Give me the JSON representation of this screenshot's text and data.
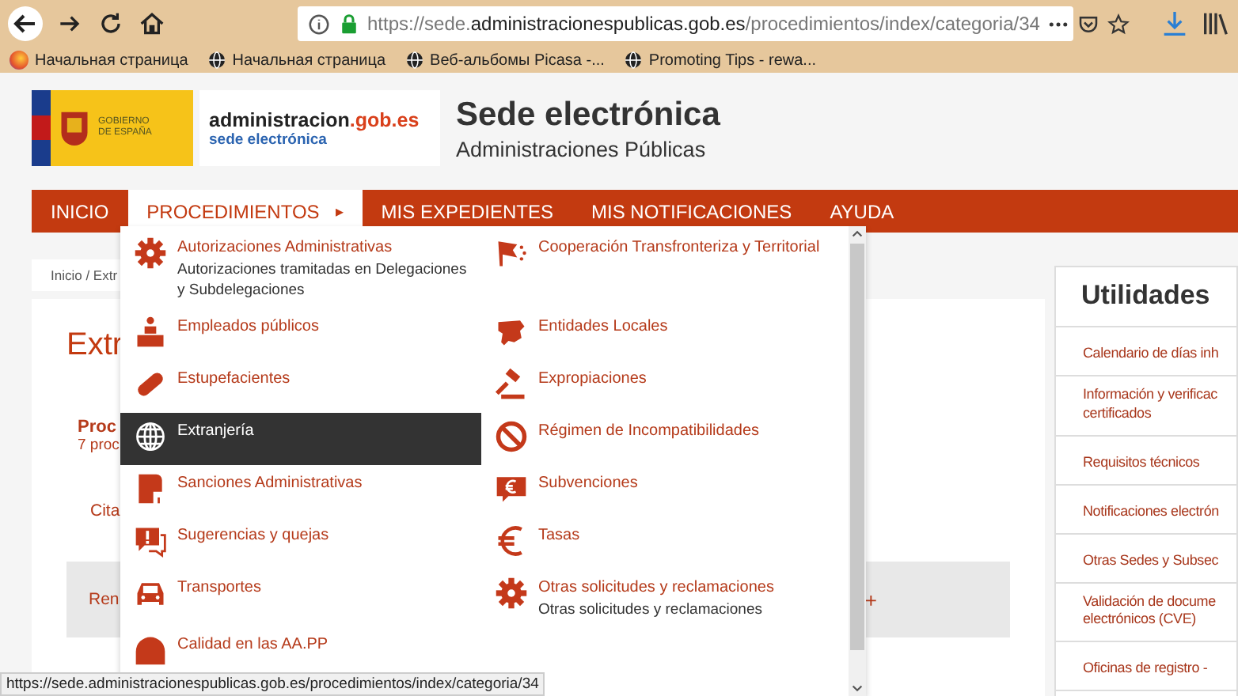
{
  "browser": {
    "url": {
      "scheme": "https://sede.",
      "host": "administracionespublicas.gob.es",
      "path": "/procedimientos/index/categoria/34"
    },
    "bookmarks": [
      {
        "label": "Начальная страница",
        "kind": "browser"
      },
      {
        "label": "Начальная страница",
        "kind": "globe"
      },
      {
        "label": "Веб-альбомы Picasa -...",
        "kind": "globe"
      },
      {
        "label": "Promoting Tips - rewa...",
        "kind": "globe"
      }
    ]
  },
  "header": {
    "gov_logo": "GOBIERNO DE ESPAÑA",
    "admin_logo": {
      "name": "administracion",
      "domain": ".gob.es",
      "sub": "sede electrónica"
    },
    "title": "Sede electrónica",
    "subtitle": "Administraciones Públicas"
  },
  "nav": [
    {
      "label": "INICIO",
      "selected": false
    },
    {
      "label": "PROCEDIMIENTOS",
      "selected": true,
      "arrow": "▸"
    },
    {
      "label": "MIS EXPEDIENTES",
      "selected": false
    },
    {
      "label": "MIS NOTIFICACIONES",
      "selected": false
    },
    {
      "label": "AYUDA",
      "selected": false
    }
  ],
  "menu": {
    "columns": [
      [
        {
          "label": "Autorizaciones Administrativas",
          "description": "Autorizaciones tramitadas en Delegaciones y Subdelegaciones",
          "kind": "gear",
          "selected": false
        },
        {
          "label": "Empleados públicos",
          "kind": "podium",
          "selected": false
        },
        {
          "label": "Estupefacientes",
          "kind": "pill",
          "selected": false
        },
        {
          "label": "Extranjería",
          "kind": "globe",
          "selected": true
        },
        {
          "label": "Sanciones Administrativas",
          "kind": "document",
          "selected": false
        },
        {
          "label": "Sugerencias y quejas",
          "kind": "speech",
          "selected": false
        },
        {
          "label": "Transportes",
          "kind": "car",
          "selected": false
        },
        {
          "label": "Calidad en las AA.PP",
          "kind": "dome",
          "selected": false
        }
      ],
      [
        {
          "label": "Cooperación Transfronteriza y Territorial",
          "kind": "flag",
          "selected": false
        },
        {
          "label": "Entidades Locales",
          "kind": "map",
          "selected": false
        },
        {
          "label": "Expropiaciones",
          "kind": "gavel",
          "selected": false
        },
        {
          "label": "Régimen de Incompatibilidades",
          "kind": "ban",
          "selected": false
        },
        {
          "label": "Subvenciones",
          "kind": "euro-bubble",
          "selected": false
        },
        {
          "label": "Tasas",
          "kind": "euro",
          "selected": false
        },
        {
          "label": "Otras solicitudes y reclamaciones",
          "description": "Otras solicitudes y reclamaciones",
          "kind": "gear",
          "selected": false
        }
      ]
    ]
  },
  "page": {
    "breadcrumb": "Inicio / Extr",
    "heading": "Extr",
    "section_title": "Proc",
    "section_count": "7 proc",
    "links": [
      "Cita",
      "Ren"
    ],
    "expand": "+"
  },
  "utilidades": {
    "title": "Utilidades",
    "links": [
      [
        "Calendario de días inh"
      ],
      [
        "Información y verificac",
        "certificados"
      ],
      [
        "Requisitos técnicos"
      ],
      [
        "Notificaciones electrón"
      ],
      [
        "Otras Sedes y Subsec"
      ],
      [
        "Validación de docume",
        "electrónicos (CVE)"
      ],
      [
        "Oficinas de registro -"
      ]
    ]
  },
  "status_bar": "https://sede.administracionespublicas.gob.es/procedimientos/index/categoria/34"
}
